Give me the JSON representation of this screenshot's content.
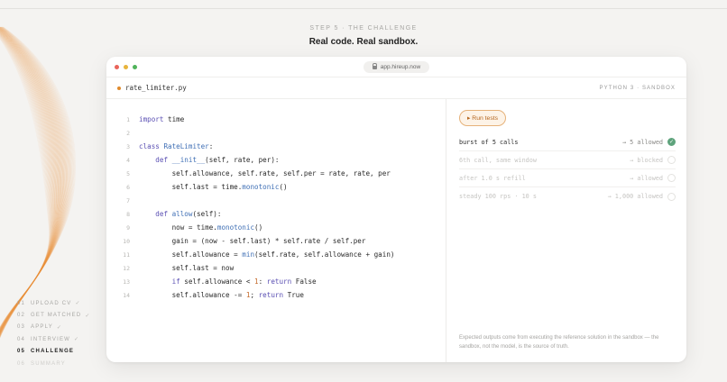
{
  "header": {
    "step_label": "STEP 5 · THE CHALLENGE",
    "headline": "Real code. Real sandbox."
  },
  "progress_steps": [
    {
      "num": "01",
      "label": "UPLOAD CV",
      "check": "✓",
      "state": "done"
    },
    {
      "num": "02",
      "label": "GET MATCHED",
      "check": "✓",
      "state": "done"
    },
    {
      "num": "03",
      "label": "APPLY",
      "check": "✓",
      "state": "done"
    },
    {
      "num": "04",
      "label": "INTERVIEW",
      "check": "✓",
      "state": "done"
    },
    {
      "num": "05",
      "label": "CHALLENGE",
      "check": "",
      "state": "active"
    },
    {
      "num": "06",
      "label": "SUMMARY",
      "check": "",
      "state": "upcoming"
    }
  ],
  "window": {
    "url": "app.hireup.now",
    "file_name": "rate_limiter.py",
    "language": "PYTHON 3 · SANDBOX"
  },
  "code_lines": [
    {
      "n": "1",
      "text": "import time"
    },
    {
      "n": "2",
      "text": ""
    },
    {
      "n": "3",
      "text": "class RateLimiter:"
    },
    {
      "n": "4",
      "text": "    def __init__(self, rate, per):"
    },
    {
      "n": "5",
      "text": "        self.allowance, self.rate, self.per = rate, rate, per"
    },
    {
      "n": "6",
      "text": "        self.last = time.monotonic()"
    },
    {
      "n": "7",
      "text": ""
    },
    {
      "n": "8",
      "text": "    def allow(self):"
    },
    {
      "n": "9",
      "text": "        now = time.monotonic()"
    },
    {
      "n": "10",
      "text": "        gain = (now - self.last) * self.rate / self.per"
    },
    {
      "n": "11",
      "text": "        self.allowance = min(self.rate, self.allowance + gain)"
    },
    {
      "n": "12",
      "text": "        self.last = now"
    },
    {
      "n": "13",
      "text": "        if self.allowance < 1: return False"
    },
    {
      "n": "14",
      "text": "        self.allowance -= 1; return True"
    }
  ],
  "tests": {
    "run_label": "▸ Run tests",
    "items": [
      {
        "name": "burst of 5 calls",
        "result": "→ 5 allowed",
        "state": "passed",
        "mark": "✓"
      },
      {
        "name": "6th call, same window",
        "result": "→ blocked",
        "state": "pending",
        "mark": ""
      },
      {
        "name": "after 1.0 s refill",
        "result": "→ allowed",
        "state": "pending",
        "mark": ""
      },
      {
        "name": "steady 100 rps · 10 s",
        "result": "→ 1,000 allowed",
        "state": "pending",
        "mark": ""
      }
    ],
    "note": "Expected outputs come from executing the reference solution in the sandbox — the sandbox, not the model, is the source of truth."
  }
}
